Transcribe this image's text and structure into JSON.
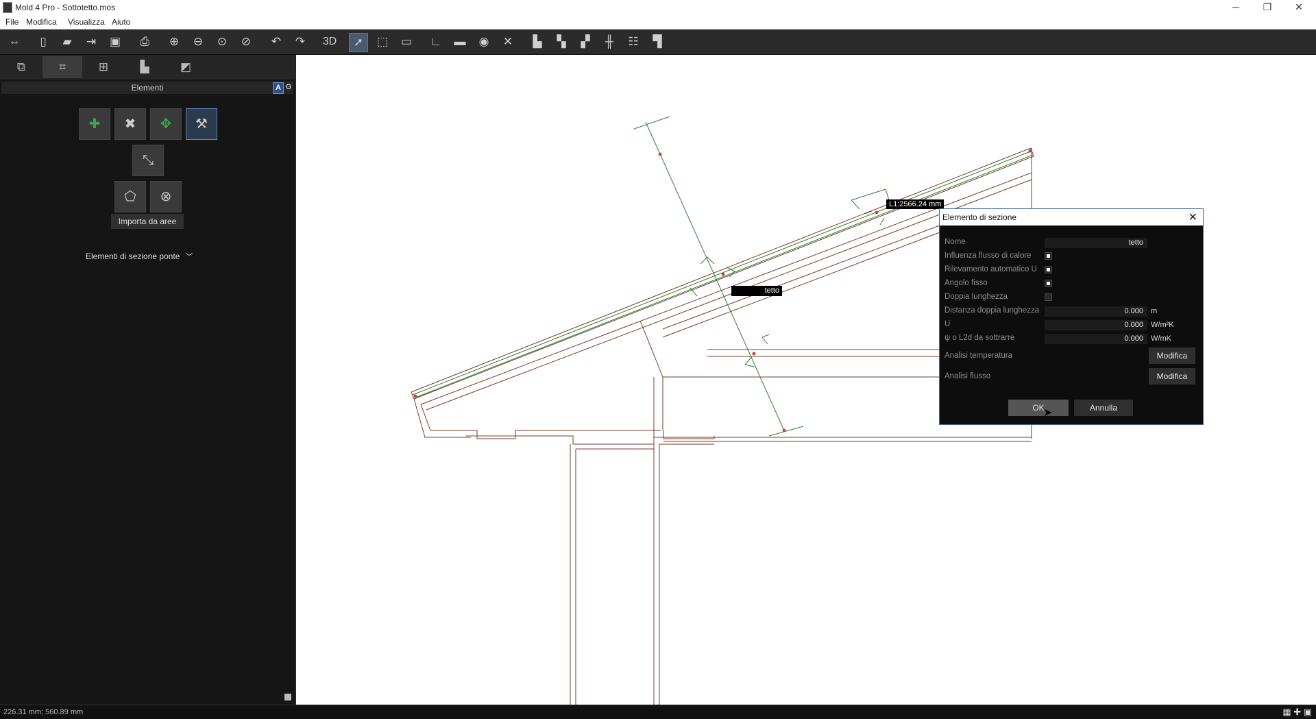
{
  "window": {
    "title": "Mold 4 Pro - Sottotetto.mos",
    "controls": {
      "minimize": "─",
      "restore": "❐",
      "close": "✕"
    }
  },
  "menu": {
    "items": [
      "File",
      "Modifica",
      "Visualizza",
      "Aiuto"
    ]
  },
  "toolbar": {
    "view3d_label": "3D"
  },
  "left_panel": {
    "header": "Elementi",
    "mode_a": "A",
    "mode_g": "G",
    "import_label": "Importa da aree",
    "dropdown_label": "Elementi di sezione ponte"
  },
  "canvas": {
    "dimension_label": "L1:2566.24 mm",
    "element_tag": "tetto"
  },
  "dialog": {
    "title": "Elemento di sezione",
    "fields": {
      "nome": {
        "label": "Nome",
        "value": "tetto"
      },
      "influenza": {
        "label": "Influenza flusso di calore",
        "checked": true
      },
      "rilevamento": {
        "label": "Rilevamento automatico U",
        "checked": true
      },
      "angolo": {
        "label": "Angolo fisso",
        "checked": true
      },
      "doppia": {
        "label": "Doppia lunghezza",
        "checked": false
      },
      "distanza": {
        "label": "Distanza doppia lunghezza",
        "value": "0.000",
        "unit": "m"
      },
      "u": {
        "label": "U",
        "value": "0.000",
        "unit": "W/m²K"
      },
      "psi": {
        "label": "ψ o L2d da sottrarre",
        "value": "0.000",
        "unit": "W/mK"
      },
      "analisi_temp": {
        "label": "Analisi temperatura",
        "button": "Modifica"
      },
      "analisi_flusso": {
        "label": "Analisi flusso",
        "button": "Modifica"
      }
    },
    "ok_label": "OK",
    "cancel_label": "Annulla"
  },
  "status": {
    "coordinates": "226.31 mm; 560.89 mm"
  }
}
